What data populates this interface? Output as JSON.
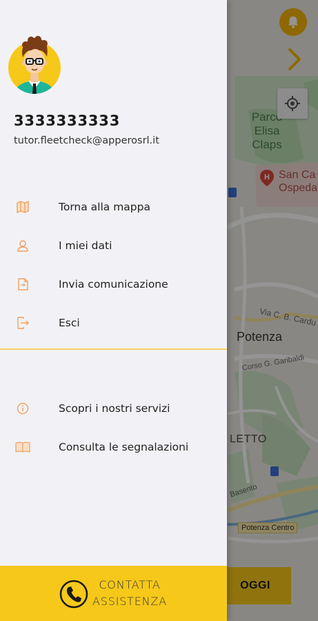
{
  "map": {
    "park_label": "Parco\nElisa Claps",
    "hospital_label": "San Ca\nOspeda",
    "city_label": "Potenza",
    "street1_label": "Via C. B. Cardu",
    "street2_label": "Corso G. Garibaldi",
    "district_label": "LETTO",
    "river_label": "Basento",
    "station_label": "Potenza Centro",
    "oggi_label": "OGGI"
  },
  "profile": {
    "phone": "3333333333",
    "email": "tutor.fleetcheck@apperosrl.it"
  },
  "menu": [
    {
      "label": "Torna alla mappa",
      "icon": "map-icon"
    },
    {
      "label": "I miei dati",
      "icon": "user-icon"
    },
    {
      "label": "Invia comunicazione",
      "icon": "send-document-icon"
    },
    {
      "label": "Esci",
      "icon": "logout-icon"
    }
  ],
  "secondary_menu": [
    {
      "label": "Scopri i nostri servizi",
      "icon": "info-icon"
    },
    {
      "label": "Consulta le segnalazioni",
      "icon": "book-icon"
    }
  ],
  "assistance": {
    "line1": "CONTATTA",
    "line2": "ASSISTENZA"
  },
  "colors": {
    "accent_yellow": "#f6c819",
    "icon_orange": "#f0a060",
    "drawer_bg": "#f2f2f6"
  }
}
